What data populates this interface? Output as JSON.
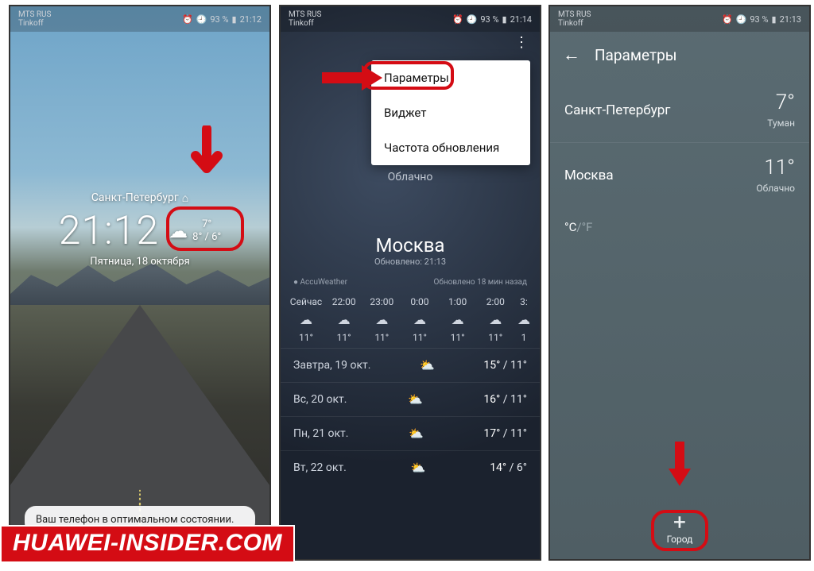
{
  "status": {
    "carrier": "MTS RUS",
    "bank": "Tinkoff",
    "battery": "93 %",
    "t1": "21:12",
    "t2": "21:14",
    "t3": "21:13",
    "alarm_icon": "⏰"
  },
  "p1": {
    "city": "Санкт-Петербург",
    "home_icon": "⌂",
    "clock": "21:12",
    "temp_now": "7°",
    "temp_hilo": "8° / 6°",
    "date": "Пятница, 18 октября",
    "toast": "Ваш телефон в оптимальном состоянии."
  },
  "p2": {
    "menu": {
      "params": "Параметры",
      "widget": "Виджет",
      "update_freq": "Частота обновления"
    },
    "cond_top": "Облачно",
    "city": "Москва",
    "updated": "Обновлено: 21:13",
    "source": "AccuWeather",
    "src_updated": "Обновлено 18 мин назад",
    "hours": [
      {
        "l": "Сейчас",
        "t": "11°"
      },
      {
        "l": "22:00",
        "t": "11°"
      },
      {
        "l": "23:00",
        "t": "11°"
      },
      {
        "l": "0:00",
        "t": "11°"
      },
      {
        "l": "1:00",
        "t": "11°"
      },
      {
        "l": "2:00",
        "t": "11°"
      },
      {
        "l": "3:",
        "t": "1"
      }
    ],
    "days": [
      {
        "d": "Завтра, 19 окт.",
        "hi": "15°",
        "lo": "11°"
      },
      {
        "d": "Вс, 20 окт.",
        "hi": "16°",
        "lo": "11°"
      },
      {
        "d": "Пн, 21 окт.",
        "hi": "17°",
        "lo": "11°"
      },
      {
        "d": "Вт, 22 окт.",
        "hi": "14°",
        "lo": "6°"
      }
    ]
  },
  "p3": {
    "title": "Параметры",
    "cities": [
      {
        "name": "Санкт-Петербург",
        "temp": "7°",
        "cond": "Туман"
      },
      {
        "name": "Москва",
        "temp": "11°",
        "cond": "Облачно"
      }
    ],
    "unit_c": "°C",
    "unit_sep": "/",
    "unit_f": "°F",
    "add_label": "Город"
  },
  "watermark": "HUAWEI-INSIDER.COM"
}
